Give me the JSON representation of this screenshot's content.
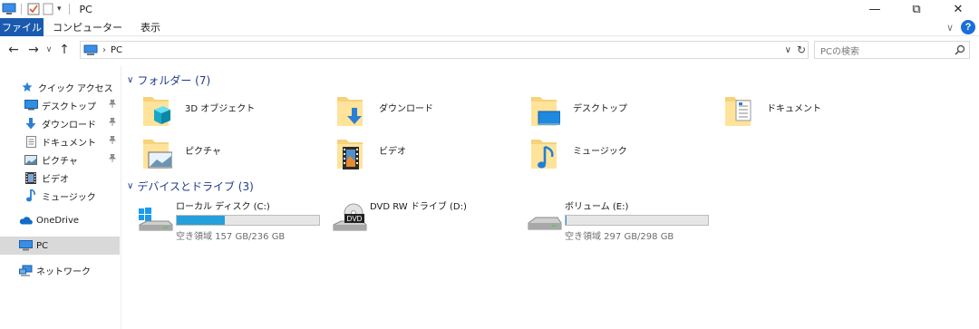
{
  "window": {
    "title": "PC",
    "qat_dropdown": "▾",
    "controls": {
      "minimize": "—",
      "restore": "⧉",
      "close": "✕"
    }
  },
  "ribbon": {
    "tabs": [
      {
        "label": "ファイル",
        "active": true
      },
      {
        "label": "コンピューター",
        "active": false
      },
      {
        "label": "表示",
        "active": false
      }
    ],
    "collapse_glyph": "∨",
    "help_glyph": "?"
  },
  "address": {
    "back": "←",
    "forward": "→",
    "recent": "∨",
    "up": "↑",
    "separator": "›",
    "path": "PC",
    "dropdown": "∨",
    "refresh": "↻"
  },
  "search": {
    "placeholder": "PCの検索"
  },
  "nav": {
    "quick_access": "クイック アクセス",
    "pinned": [
      {
        "label": "デスクトップ",
        "icon": "desktop-icon",
        "pinned": true
      },
      {
        "label": "ダウンロード",
        "icon": "download-icon",
        "pinned": true
      },
      {
        "label": "ドキュメント",
        "icon": "documents-icon",
        "pinned": true
      },
      {
        "label": "ピクチャ",
        "icon": "pictures-icon",
        "pinned": true
      },
      {
        "label": "ビデオ",
        "icon": "videos-icon",
        "pinned": false
      },
      {
        "label": "ミュージック",
        "icon": "music-icon",
        "pinned": false
      }
    ],
    "onedrive": "OneDrive",
    "pc": "PC",
    "network": "ネットワーク",
    "pin_glyph": "📌"
  },
  "folders": {
    "header": "フォルダー (7)",
    "chevron": "∨",
    "items": [
      {
        "label": "3D オブジェクト",
        "icon": "3d-objects-folder-icon"
      },
      {
        "label": "ダウンロード",
        "icon": "downloads-folder-icon"
      },
      {
        "label": "デスクトップ",
        "icon": "desktop-folder-icon"
      },
      {
        "label": "ドキュメント",
        "icon": "documents-folder-icon"
      },
      {
        "label": "ピクチャ",
        "icon": "pictures-folder-icon"
      },
      {
        "label": "ビデオ",
        "icon": "videos-folder-icon"
      },
      {
        "label": "ミュージック",
        "icon": "music-folder-icon"
      }
    ]
  },
  "drives": {
    "header": "デバイスとドライブ (3)",
    "chevron": "∨",
    "items": [
      {
        "label": "ローカル ディスク (C:)",
        "free_text": "空き領域 157 GB/236 GB",
        "used_fraction": 0.335,
        "icon": "windows-drive-icon",
        "has_bar": true
      },
      {
        "label": "DVD RW ドライブ (D:)",
        "icon": "dvd-drive-icon",
        "has_bar": false,
        "badge": "DVD"
      },
      {
        "label": "ボリューム (E:)",
        "free_text": "空き領域 297 GB/298 GB",
        "used_fraction": 0.003,
        "icon": "hard-drive-icon",
        "has_bar": true
      }
    ]
  },
  "colors": {
    "accent": "#1a5bb0",
    "group_header": "#1e3c8c",
    "bar_fill": "#26a0da",
    "folder": "#f6d27a"
  }
}
